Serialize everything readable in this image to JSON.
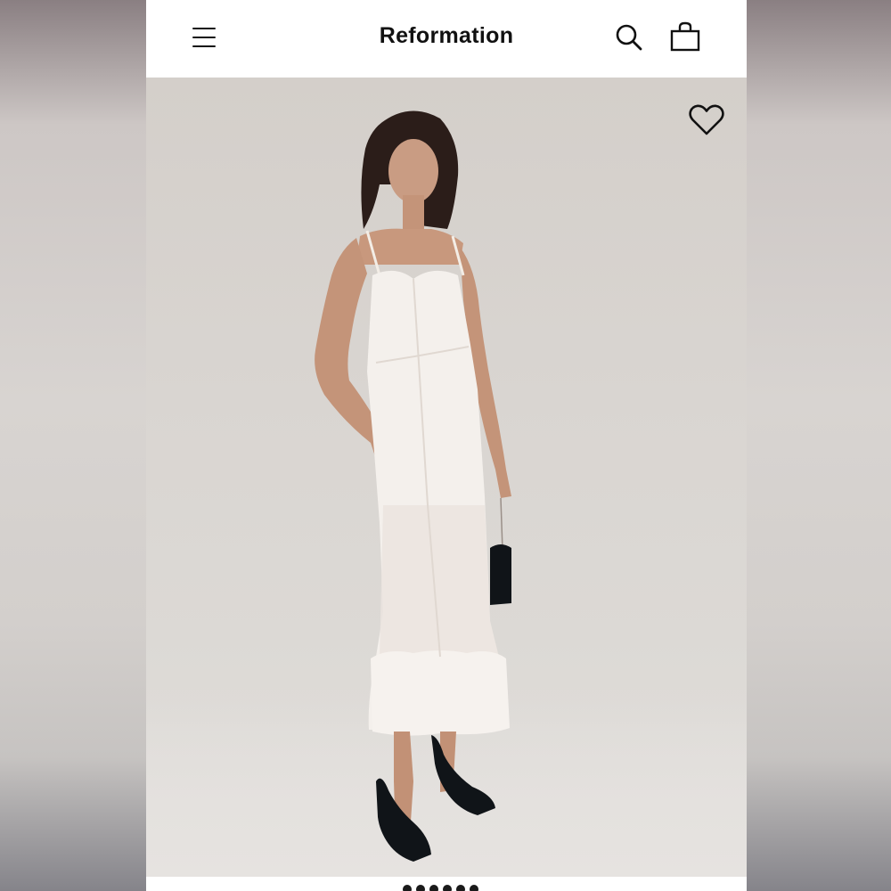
{
  "header": {
    "brand": "Reformation",
    "icons": {
      "menu": "hamburger-menu-icon",
      "search": "search-icon",
      "bag": "shopping-bag-icon"
    }
  },
  "product": {
    "image": {
      "description_icon": "favorite-heart-icon"
    }
  },
  "carousel": {
    "dot_count": 6
  },
  "colors": {
    "text": "#111111",
    "header_bg": "#ffffff",
    "photo_bg": "#d8d4d0"
  }
}
